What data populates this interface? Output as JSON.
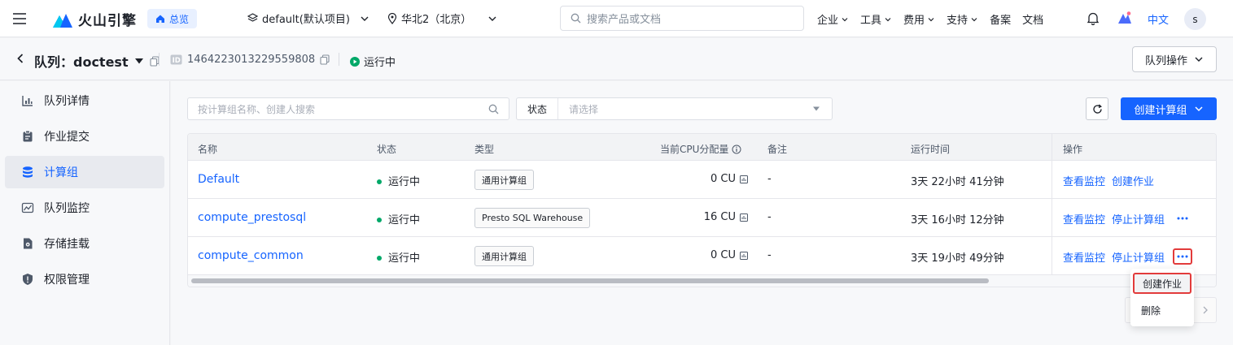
{
  "topbar": {
    "brand": "火山引擎",
    "home": "总览",
    "project": "default(默认项目)",
    "region": "华北2（北京）",
    "search_placeholder": "搜索产品或文档",
    "nav": [
      {
        "label": "企业",
        "dropdown": true
      },
      {
        "label": "工具",
        "dropdown": true
      },
      {
        "label": "费用",
        "dropdown": true
      },
      {
        "label": "支持",
        "dropdown": true
      },
      {
        "label": "备案",
        "dropdown": false
      },
      {
        "label": "文档",
        "dropdown": false
      }
    ],
    "lang": "中文",
    "avatar": "s"
  },
  "header": {
    "title": "队列：doctest",
    "id": "1464223013229559808",
    "status": "运行中",
    "queue_ops": "队列操作"
  },
  "sidebar": {
    "items": [
      {
        "label": "队列详情",
        "icon": "chart-icon"
      },
      {
        "label": "作业提交",
        "icon": "clipboard-icon"
      },
      {
        "label": "计算组",
        "icon": "database-icon",
        "active": true
      },
      {
        "label": "队列监控",
        "icon": "monitor-icon"
      },
      {
        "label": "存储挂载",
        "icon": "storage-icon"
      },
      {
        "label": "权限管理",
        "icon": "shield-icon"
      }
    ]
  },
  "toolbar": {
    "search_placeholder": "按计算组名称、创建人搜索",
    "status_label": "状态",
    "status_placeholder": "请选择",
    "create_label": "创建计算组"
  },
  "table": {
    "columns": [
      "名称",
      "状态",
      "类型",
      "当前CPU分配量",
      "备注",
      "运行时间",
      "操作"
    ],
    "rows": [
      {
        "name": "Default",
        "status": "运行中",
        "type": "通用计算组",
        "cpu": "0 CU",
        "note": "-",
        "runtime": "3天 22小时 41分钟",
        "ops": [
          "查看监控",
          "创建作业"
        ],
        "more": false
      },
      {
        "name": "compute_prestosql",
        "status": "运行中",
        "type": "Presto SQL Warehouse",
        "cpu": "16 CU",
        "note": "-",
        "runtime": "3天 16小时 12分钟",
        "ops": [
          "查看监控",
          "停止计算组"
        ],
        "more": true
      },
      {
        "name": "compute_common",
        "status": "运行中",
        "type": "通用计算组",
        "cpu": "0 CU",
        "note": "-",
        "runtime": "3天 19小时 49分钟",
        "ops": [
          "查看监控",
          "停止计算组"
        ],
        "more": true
      }
    ]
  },
  "dropdown": {
    "items": [
      "创建作业",
      "删除"
    ]
  },
  "colors": {
    "primary": "#1664ff",
    "running": "#00a868",
    "highlight": "#e23b3b"
  }
}
